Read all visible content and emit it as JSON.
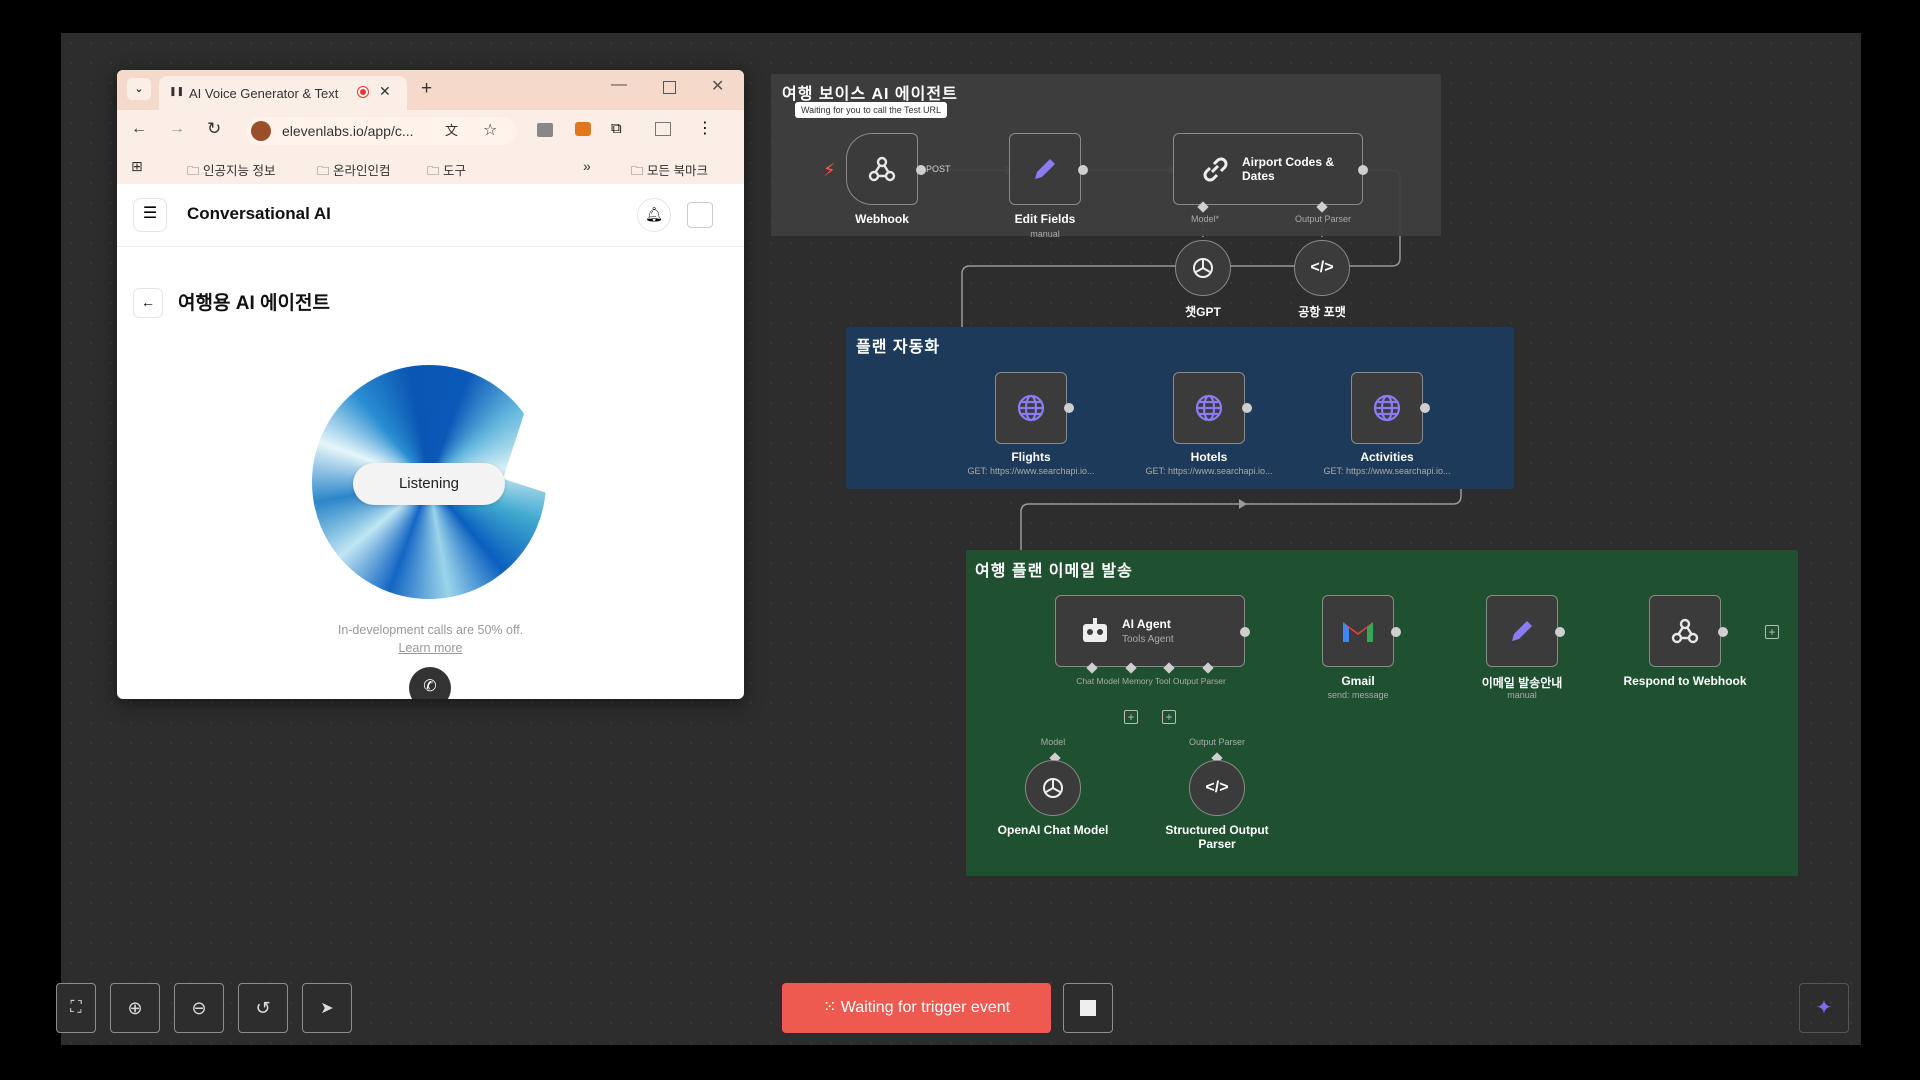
{
  "browser": {
    "tab_title": "AI Voice Generator & Text",
    "new_tab": "+",
    "url": "elevenlabs.io/app/c...",
    "bookmarks": [
      "인공지능 정보",
      "온라인인컴",
      "도구"
    ],
    "bookmarks_overflow": "»",
    "all_bookmarks": "모든 북마크",
    "app_title": "Conversational AI",
    "page_title": "여행용 AI 에이전트",
    "listening": "Listening",
    "promo_text": "In-development calls are 50% off.",
    "learn_more": "Learn more"
  },
  "workflow": {
    "groups": [
      {
        "title": "여행 보이스 AI 에이전트",
        "color": "#3e3e3e"
      },
      {
        "title": "플랜 자동화",
        "color": "#1d3a5a"
      },
      {
        "title": "여행 플랜 이메일 발송",
        "color": "#1f5131"
      }
    ],
    "tooltip": "Waiting for you to call the Test URL",
    "nodes": {
      "webhook": {
        "label": "Webhook",
        "edge": "POST"
      },
      "edit_fields": {
        "label": "Edit Fields",
        "sub": "manual"
      },
      "airport": {
        "label": "Airport Codes & Dates",
        "port_model": "Model*",
        "port_parser": "Output Parser"
      },
      "chatgpt": {
        "label": "챗GPT"
      },
      "airport_format": {
        "label": "공항 포맷"
      },
      "flights": {
        "label": "Flights",
        "sub": "GET: https://www.searchapi.io..."
      },
      "hotels": {
        "label": "Hotels",
        "sub": "GET: https://www.searchapi.io..."
      },
      "activities": {
        "label": "Activities",
        "sub": "GET: https://www.searchapi.io..."
      },
      "ai_agent": {
        "label": "AI Agent",
        "sub": "Tools Agent",
        "ports": "Chat Model Memory  Tool Output Parser"
      },
      "gmail": {
        "label": "Gmail",
        "sub": "send: message"
      },
      "email_notice": {
        "label": "이메일 발송안내",
        "sub": "manual"
      },
      "respond": {
        "label": "Respond to Webhook"
      },
      "openai": {
        "label": "OpenAI Chat Model",
        "port": "Model"
      },
      "structured": {
        "label": "Structured Output Parser",
        "port": "Output Parser"
      }
    }
  },
  "footer": {
    "trigger_button": "Waiting for trigger event"
  },
  "colors": {
    "trigger": "#ee5a4f",
    "accent": "#7b6cf0"
  }
}
